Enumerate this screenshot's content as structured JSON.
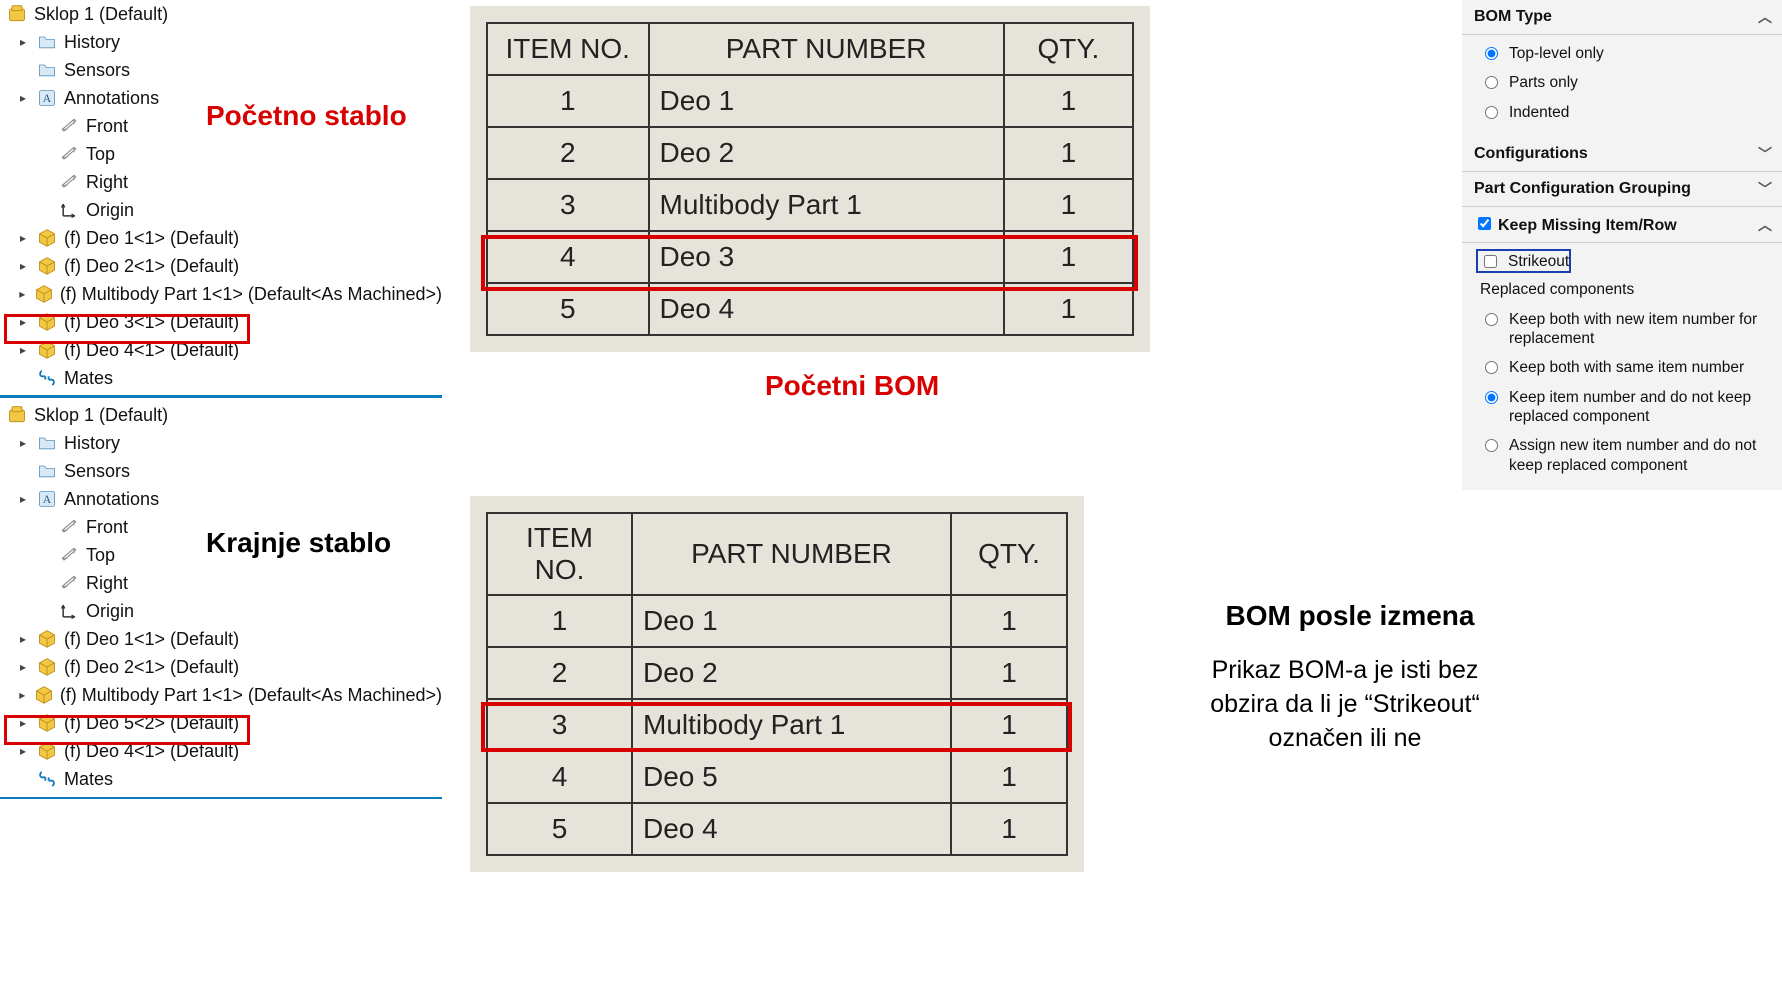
{
  "annotations": {
    "tree_top": "Početno stablo",
    "tree_bottom": "Krajnje stablo",
    "bom_top": "Početni BOM",
    "bom_after_title": "BOM posle izmena",
    "bom_after_desc1": "Prikaz BOM-a je isti bez",
    "bom_after_desc2": "obzira da li je “Strikeout“",
    "bom_after_desc3": "označen ili ne"
  },
  "tree1": {
    "root": "Sklop 1  (Default)",
    "items": [
      "History",
      "Sensors",
      "Annotations",
      "Front",
      "Top",
      "Right",
      "Origin",
      "(f) Deo 1<1> (Default)",
      "(f) Deo 2<1> (Default)",
      "(f) Multibody Part 1<1> (Default<As Machined>)",
      "(f) Deo 3<1> (Default)",
      "(f) Deo 4<1> (Default)",
      "Mates"
    ]
  },
  "tree2": {
    "root": "Sklop 1  (Default)",
    "items": [
      "History",
      "Sensors",
      "Annotations",
      "Front",
      "Top",
      "Right",
      "Origin",
      "(f) Deo 1<1> (Default)",
      "(f) Deo 2<1> (Default)",
      "(f) Multibody Part 1<1> (Default<As Machined>)",
      "(f) Deo 5<2> (Default)",
      "(f) Deo 4<1> (Default)",
      "Mates"
    ]
  },
  "bom_headers": {
    "item": "ITEM NO.",
    "part": "PART NUMBER",
    "qty": "QTY."
  },
  "bom1": [
    {
      "n": "1",
      "p": "Deo 1",
      "q": "1"
    },
    {
      "n": "2",
      "p": "Deo 2",
      "q": "1"
    },
    {
      "n": "3",
      "p": "Multibody Part 1",
      "q": "1"
    },
    {
      "n": "4",
      "p": "Deo 3",
      "q": "1"
    },
    {
      "n": "5",
      "p": "Deo 4",
      "q": "1"
    }
  ],
  "bom2": [
    {
      "n": "1",
      "p": "Deo 1",
      "q": "1"
    },
    {
      "n": "2",
      "p": "Deo 2",
      "q": "1"
    },
    {
      "n": "3",
      "p": "Multibody Part 1",
      "q": "1"
    },
    {
      "n": "4",
      "p": "Deo 5",
      "q": "1"
    },
    {
      "n": "5",
      "p": "Deo 4",
      "q": "1"
    }
  ],
  "props": {
    "bom_type": {
      "title": "BOM Type",
      "top": "Top-level only",
      "parts": "Parts only",
      "indented": "Indented",
      "selected": "top"
    },
    "configurations": "Configurations",
    "part_grouping": "Part Configuration Grouping",
    "keep_missing": {
      "title": "Keep Missing Item/Row",
      "checked": true,
      "strikeout_label": "Strikeout",
      "strikeout_checked": false,
      "replaced_title": "Replaced components",
      "o1": "Keep both with new item number for replacement",
      "o2": "Keep both with same item number",
      "o3": "Keep item number and do not keep replaced component",
      "o4": "Assign new item number and do not keep replaced component",
      "selected": "o3"
    }
  }
}
